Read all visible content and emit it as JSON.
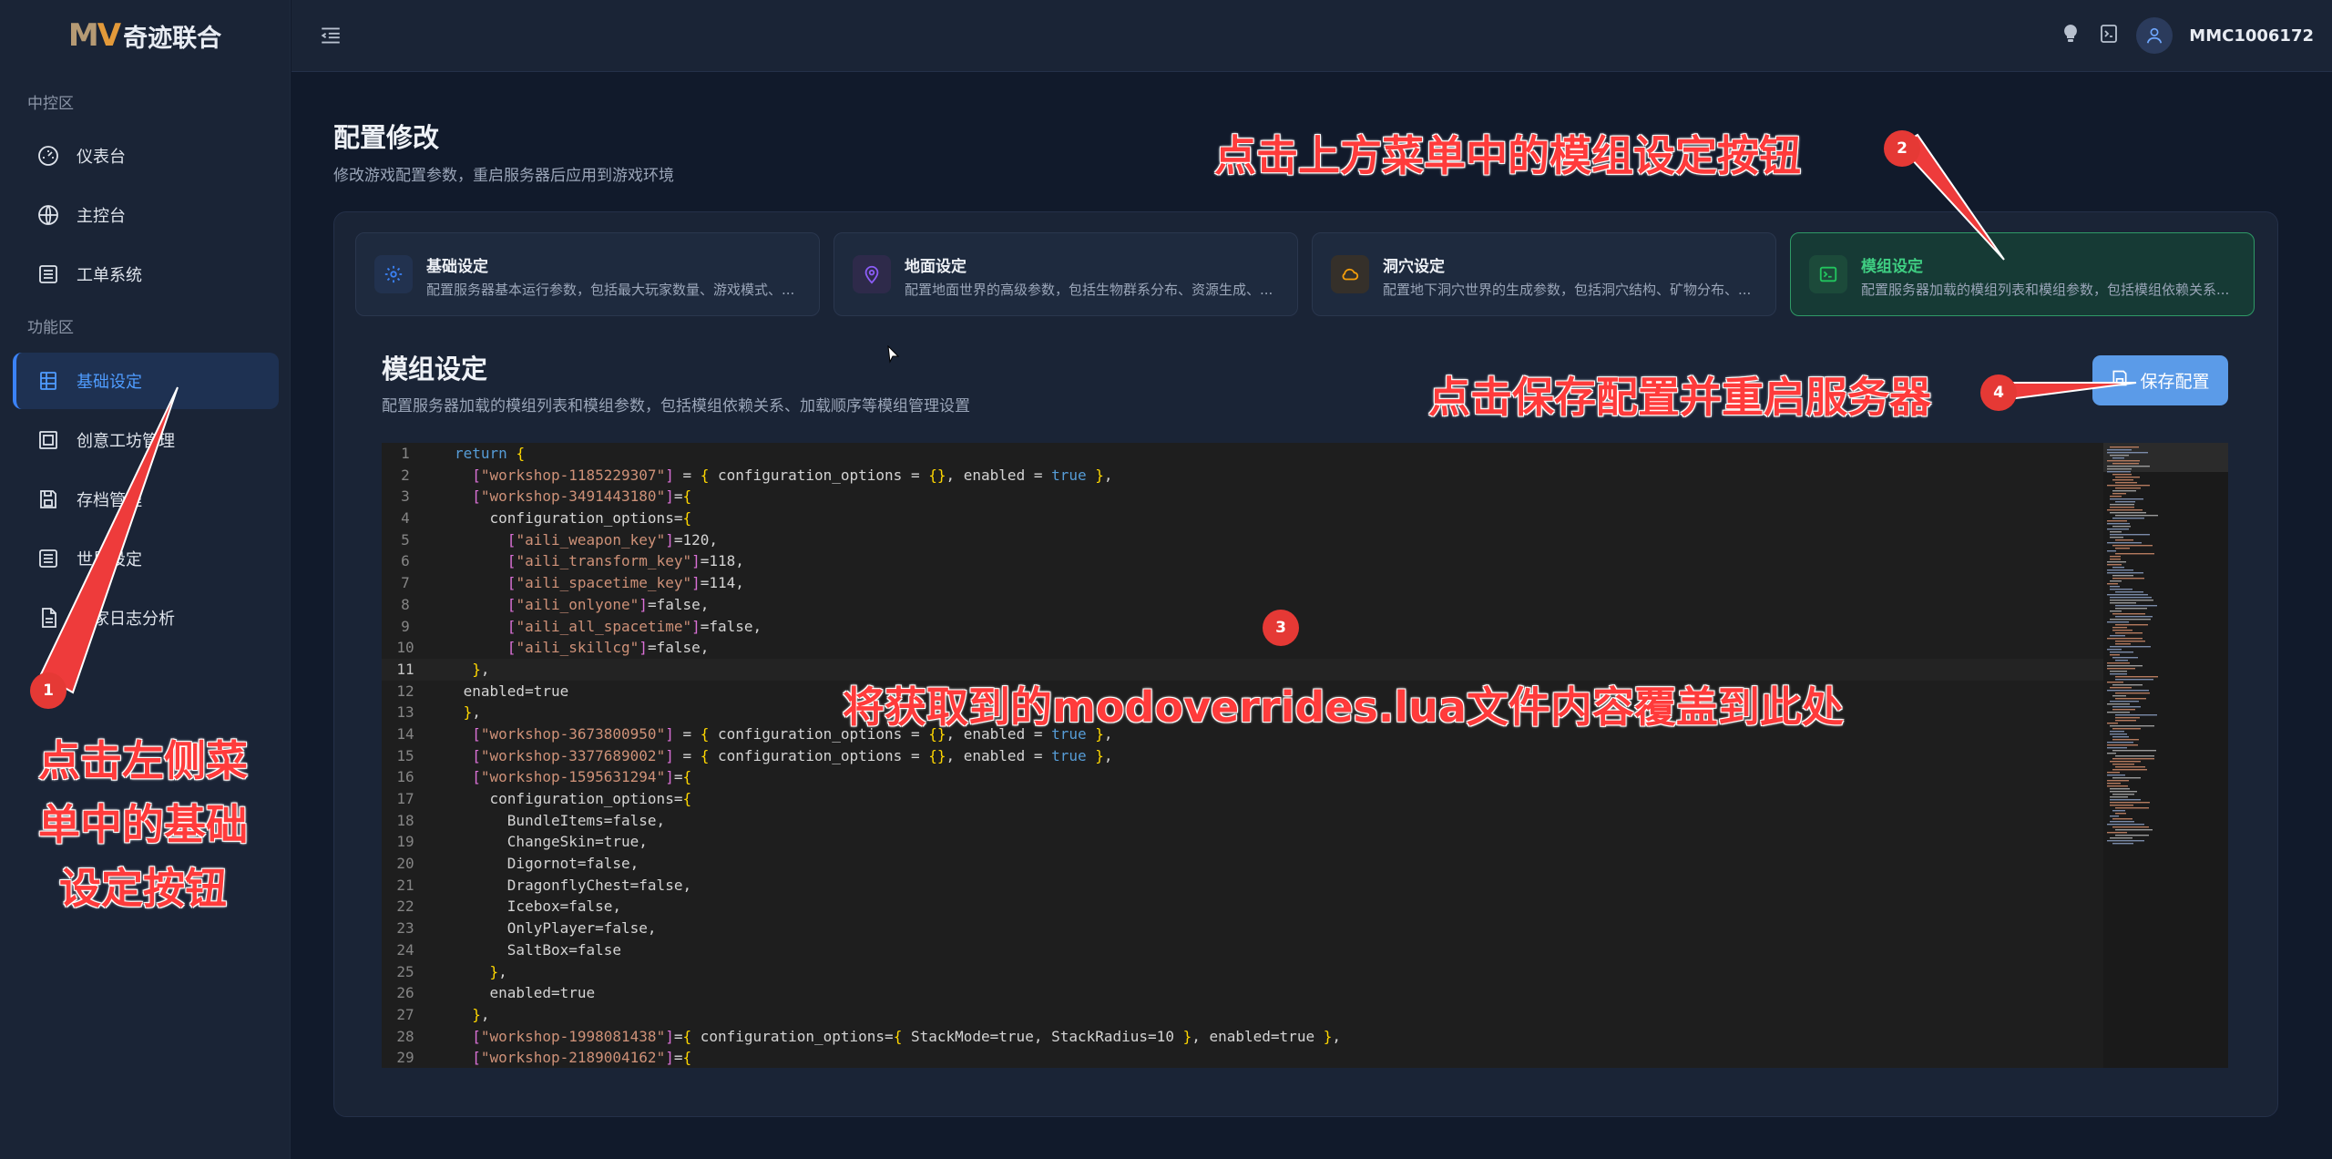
{
  "app": {
    "logo_mark_m": "M",
    "logo_mark_v": "V",
    "logo_text": "奇迹联合",
    "username": "MMC1006172"
  },
  "sidebar": {
    "section1": "中控区",
    "section2": "功能区",
    "items": [
      {
        "label": "仪表台",
        "icon": "gauge-icon"
      },
      {
        "label": "主控台",
        "icon": "globe-icon"
      },
      {
        "label": "工单系统",
        "icon": "list-icon"
      },
      {
        "label": "基础设定",
        "icon": "sliders-icon",
        "active": true
      },
      {
        "label": "创意工坊管理",
        "icon": "grid-icon"
      },
      {
        "label": "存档管理",
        "icon": "save-icon"
      },
      {
        "label": "世界设定",
        "icon": "list-icon"
      },
      {
        "label": "玩家日志分析",
        "icon": "file-icon"
      }
    ]
  },
  "page": {
    "title": "配置修改",
    "subtitle": "修改游戏配置参数，重启服务器后应用到游戏环境"
  },
  "tabs": [
    {
      "name": "基础设定",
      "desc": "配置服务器基本运行参数，包括最大玩家数量、游戏模式、...",
      "icon": "gear-icon",
      "color": "#3b82f6"
    },
    {
      "name": "地面设定",
      "desc": "配置地面世界的高级参数，包括生物群系分布、资源生成、...",
      "icon": "map-pin-icon",
      "color": "#8b5cf6"
    },
    {
      "name": "洞穴设定",
      "desc": "配置地下洞穴世界的生成参数，包括洞穴结构、矿物分布、...",
      "icon": "cloud-icon",
      "color": "#f59e0b"
    },
    {
      "name": "模组设定",
      "desc": "配置服务器加载的模组列表和模组参数，包括模组依赖关系...",
      "icon": "terminal-icon",
      "color": "#22c55e",
      "active": true
    }
  ],
  "section": {
    "title": "模组设定",
    "subtitle": "配置服务器加载的模组列表和模组参数，包括模组依赖关系、加载顺序等模组管理设置",
    "save_label": "保存配置"
  },
  "editor": {
    "current_line": 11,
    "lines": [
      "return {",
      "  [\"workshop-1185229307\"] = { configuration_options = {}, enabled = true },",
      "  [\"workshop-3491443180\"]={",
      "    configuration_options={",
      "      [\"aili_weapon_key\"]=120,",
      "      [\"aili_transform_key\"]=118,",
      "      [\"aili_spacetime_key\"]=114,",
      "      [\"aili_onlyone\"]=false,",
      "      [\"aili_all_spacetime\"]=false,",
      "      [\"aili_skillcg\"]=false,",
      "  },",
      " enabled=true",
      " },",
      "  [\"workshop-3673800950\"] = { configuration_options = {}, enabled = true },",
      "  [\"workshop-3377689002\"] = { configuration_options = {}, enabled = true },",
      "  [\"workshop-1595631294\"]={",
      "    configuration_options={",
      "      BundleItems=false,",
      "      ChangeSkin=true,",
      "      Digornot=false,",
      "      DragonflyChest=false,",
      "      Icebox=false,",
      "      OnlyPlayer=false,",
      "      SaltBox=false",
      "    },",
      "    enabled=true",
      "  },",
      "  [\"workshop-1998081438\"]={ configuration_options={ StackMode=true, StackRadius=10 }, enabled=true },",
      "  [\"workshop-2189004162\"]={"
    ]
  },
  "annotations": {
    "a1": "点击左侧菜单中的基础设定按钮",
    "a1_lines": [
      "点击左侧菜",
      "单中的基础",
      "设定按钮"
    ],
    "a2": "点击上方菜单中的模组设定按钮",
    "a3": "将获取到的modoverrides.lua文件内容覆盖到此处",
    "a4": "点击保存配置并重启服务器",
    "badge1": "1",
    "badge2": "2",
    "badge3": "3",
    "badge4": "4"
  }
}
